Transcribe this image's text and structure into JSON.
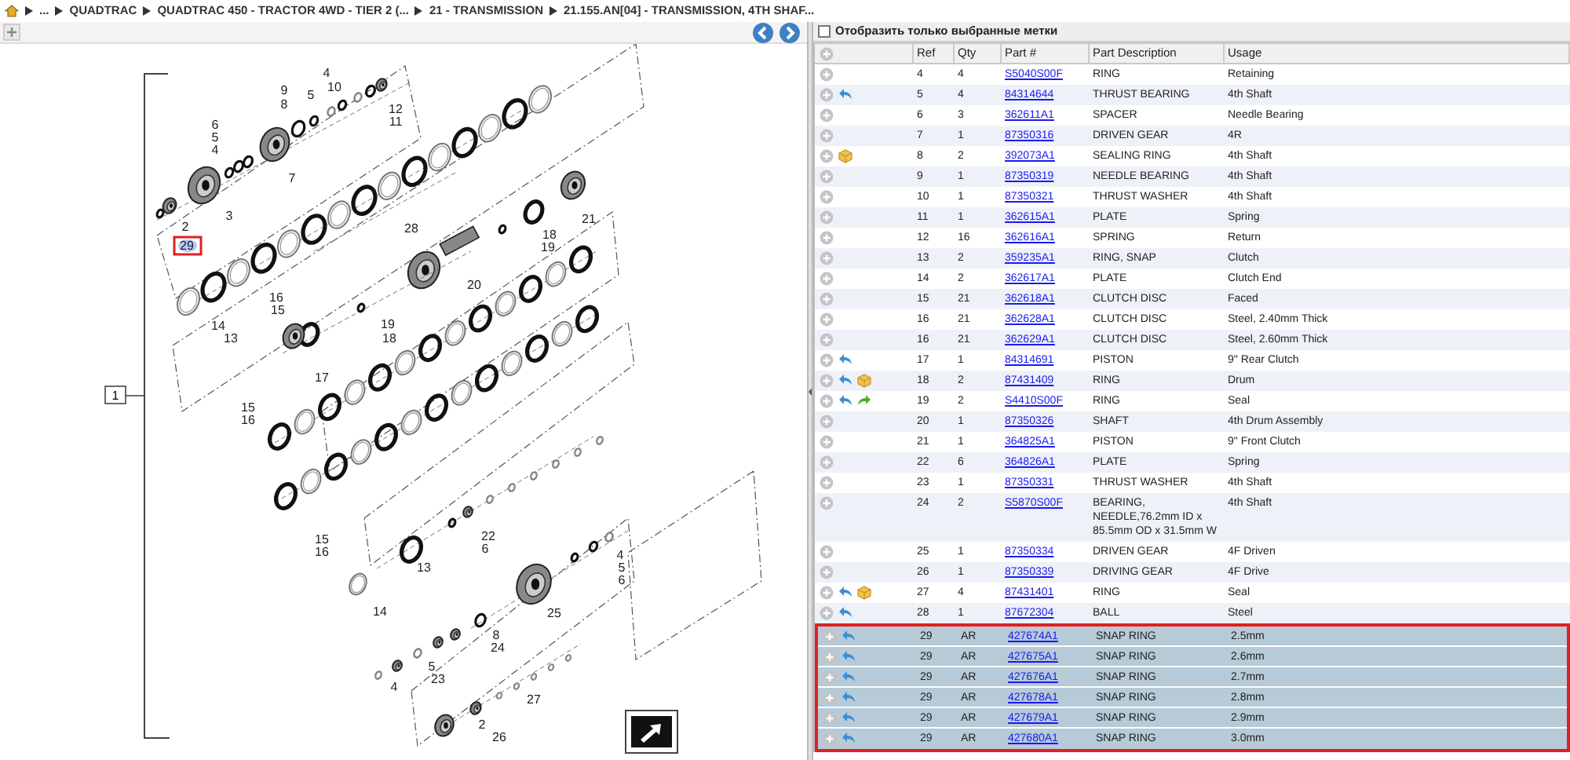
{
  "breadcrumb": [
    "...",
    "QUADTRAC",
    "QUADTRAC 450 - TRACTOR 4WD - TIER 2 (...",
    "21 - TRANSMISSION",
    "21.155.AN[04] - TRANSMISSION, 4TH SHAF..."
  ],
  "diagram": {
    "callouts": [
      {
        "label": "4",
        "selected": false
      },
      {
        "label": "9",
        "selected": false
      },
      {
        "label": "10",
        "selected": false
      },
      {
        "label": "5",
        "selected": false
      },
      {
        "label": "8",
        "selected": false
      },
      {
        "label": "12",
        "selected": false
      },
      {
        "label": "11",
        "selected": false
      },
      {
        "label": "6",
        "selected": false
      },
      {
        "label": "5",
        "selected": false
      },
      {
        "label": "4",
        "selected": false
      },
      {
        "label": "7",
        "selected": false
      },
      {
        "label": "3",
        "selected": false
      },
      {
        "label": "2",
        "selected": false
      },
      {
        "label": "29",
        "selected": true
      },
      {
        "label": "28",
        "selected": false
      },
      {
        "label": "18",
        "selected": false
      },
      {
        "label": "19",
        "selected": false
      },
      {
        "label": "21",
        "selected": false
      },
      {
        "label": "20",
        "selected": false
      },
      {
        "label": "16",
        "selected": false
      },
      {
        "label": "15",
        "selected": false
      },
      {
        "label": "14",
        "selected": false
      },
      {
        "label": "13",
        "selected": false
      },
      {
        "label": "19",
        "selected": false
      },
      {
        "label": "18",
        "selected": false
      },
      {
        "label": "17",
        "selected": false
      },
      {
        "label": "15",
        "selected": false
      },
      {
        "label": "16",
        "selected": false
      },
      {
        "label": "15",
        "selected": false
      },
      {
        "label": "16",
        "selected": false
      },
      {
        "label": "22",
        "selected": false
      },
      {
        "label": "6",
        "selected": false
      },
      {
        "label": "13",
        "selected": false
      },
      {
        "label": "14",
        "selected": false
      },
      {
        "label": "4",
        "selected": false
      },
      {
        "label": "5",
        "selected": false
      },
      {
        "label": "6",
        "selected": false
      },
      {
        "label": "25",
        "selected": false
      },
      {
        "label": "8",
        "selected": false
      },
      {
        "label": "24",
        "selected": false
      },
      {
        "label": "5",
        "selected": false
      },
      {
        "label": "23",
        "selected": false
      },
      {
        "label": "4",
        "selected": false
      },
      {
        "label": "27",
        "selected": false
      },
      {
        "label": "2",
        "selected": false
      },
      {
        "label": "26",
        "selected": false
      }
    ],
    "assembly_label": "1"
  },
  "filter": {
    "label": "Отобразить только выбранные метки",
    "checked": false
  },
  "columns": [
    "Ref",
    "Qty",
    "Part #",
    "Part Description",
    "Usage"
  ],
  "rows": [
    {
      "ref": "4",
      "qty": "4",
      "part": "S5040S00F",
      "description": "RING",
      "usage": "Retaining",
      "superseded": false,
      "kit": false,
      "replacement": false,
      "selected": false
    },
    {
      "ref": "5",
      "qty": "4",
      "part": "84314644",
      "description": "THRUST BEARING",
      "usage": "4th Shaft",
      "superseded": true,
      "kit": false,
      "replacement": false,
      "selected": false
    },
    {
      "ref": "6",
      "qty": "3",
      "part": "362611A1",
      "description": "SPACER",
      "usage": "Needle Bearing",
      "superseded": false,
      "kit": false,
      "replacement": false,
      "selected": false
    },
    {
      "ref": "7",
      "qty": "1",
      "part": "87350316",
      "description": "DRIVEN GEAR",
      "usage": "4R",
      "superseded": false,
      "kit": false,
      "replacement": false,
      "selected": false
    },
    {
      "ref": "8",
      "qty": "2",
      "part": "392073A1",
      "description": "SEALING RING",
      "usage": "4th Shaft",
      "superseded": false,
      "kit": true,
      "replacement": false,
      "selected": false
    },
    {
      "ref": "9",
      "qty": "1",
      "part": "87350319",
      "description": "NEEDLE BEARING",
      "usage": "4th Shaft",
      "superseded": false,
      "kit": false,
      "replacement": false,
      "selected": false
    },
    {
      "ref": "10",
      "qty": "1",
      "part": "87350321",
      "description": "THRUST WASHER",
      "usage": "4th Shaft",
      "superseded": false,
      "kit": false,
      "replacement": false,
      "selected": false
    },
    {
      "ref": "11",
      "qty": "1",
      "part": "362615A1",
      "description": "PLATE",
      "usage": "Spring",
      "superseded": false,
      "kit": false,
      "replacement": false,
      "selected": false
    },
    {
      "ref": "12",
      "qty": "16",
      "part": "362616A1",
      "description": "SPRING",
      "usage": "Return",
      "superseded": false,
      "kit": false,
      "replacement": false,
      "selected": false
    },
    {
      "ref": "13",
      "qty": "2",
      "part": "359235A1",
      "description": "RING, SNAP",
      "usage": "Clutch",
      "superseded": false,
      "kit": false,
      "replacement": false,
      "selected": false
    },
    {
      "ref": "14",
      "qty": "2",
      "part": "362617A1",
      "description": "PLATE",
      "usage": "Clutch End",
      "superseded": false,
      "kit": false,
      "replacement": false,
      "selected": false
    },
    {
      "ref": "15",
      "qty": "21",
      "part": "362618A1",
      "description": "CLUTCH DISC",
      "usage": "Faced",
      "superseded": false,
      "kit": false,
      "replacement": false,
      "selected": false
    },
    {
      "ref": "16",
      "qty": "21",
      "part": "362628A1",
      "description": "CLUTCH DISC",
      "usage": "Steel, 2.40mm Thick",
      "superseded": false,
      "kit": false,
      "replacement": false,
      "selected": false
    },
    {
      "ref": "16",
      "qty": "21",
      "part": "362629A1",
      "description": "CLUTCH DISC",
      "usage": "Steel, 2.60mm Thick",
      "superseded": false,
      "kit": false,
      "replacement": false,
      "selected": false
    },
    {
      "ref": "17",
      "qty": "1",
      "part": "84314691",
      "description": "PISTON",
      "usage": "9\" Rear Clutch",
      "superseded": true,
      "kit": false,
      "replacement": false,
      "selected": false
    },
    {
      "ref": "18",
      "qty": "2",
      "part": "87431409",
      "description": "RING",
      "usage": "Drum",
      "superseded": true,
      "kit": true,
      "replacement": false,
      "selected": false
    },
    {
      "ref": "19",
      "qty": "2",
      "part": "S4410S00F",
      "description": "RING",
      "usage": "Seal",
      "superseded": true,
      "kit": false,
      "replacement": true,
      "selected": false
    },
    {
      "ref": "20",
      "qty": "1",
      "part": "87350326",
      "description": "SHAFT",
      "usage": "4th Drum Assembly",
      "superseded": false,
      "kit": false,
      "replacement": false,
      "selected": false
    },
    {
      "ref": "21",
      "qty": "1",
      "part": "364825A1",
      "description": "PISTON",
      "usage": "9\" Front Clutch",
      "superseded": false,
      "kit": false,
      "replacement": false,
      "selected": false
    },
    {
      "ref": "22",
      "qty": "6",
      "part": "364826A1",
      "description": "PLATE",
      "usage": "Spring",
      "superseded": false,
      "kit": false,
      "replacement": false,
      "selected": false
    },
    {
      "ref": "23",
      "qty": "1",
      "part": "87350331",
      "description": "THRUST WASHER",
      "usage": "4th Shaft",
      "superseded": false,
      "kit": false,
      "replacement": false,
      "selected": false
    },
    {
      "ref": "24",
      "qty": "2",
      "part": "S5870S00F",
      "description": "BEARING, NEEDLE,76.2mm ID x 85.5mm OD x 31.5mm W",
      "usage": "4th Shaft",
      "superseded": false,
      "kit": false,
      "replacement": false,
      "selected": false
    },
    {
      "ref": "25",
      "qty": "1",
      "part": "87350334",
      "description": "DRIVEN GEAR",
      "usage": "4F Driven",
      "superseded": false,
      "kit": false,
      "replacement": false,
      "selected": false
    },
    {
      "ref": "26",
      "qty": "1",
      "part": "87350339",
      "description": "DRIVING GEAR",
      "usage": "4F Drive",
      "superseded": false,
      "kit": false,
      "replacement": false,
      "selected": false
    },
    {
      "ref": "27",
      "qty": "4",
      "part": "87431401",
      "description": "RING",
      "usage": "Seal",
      "superseded": true,
      "kit": true,
      "replacement": false,
      "selected": false
    },
    {
      "ref": "28",
      "qty": "1",
      "part": "87672304",
      "description": "BALL",
      "usage": "Steel",
      "superseded": true,
      "kit": false,
      "replacement": false,
      "selected": false
    },
    {
      "ref": "29",
      "qty": "AR",
      "part": "427674A1",
      "description": "SNAP RING",
      "usage": "2.5mm",
      "superseded": true,
      "kit": false,
      "replacement": false,
      "selected": true
    },
    {
      "ref": "29",
      "qty": "AR",
      "part": "427675A1",
      "description": "SNAP RING",
      "usage": "2.6mm",
      "superseded": true,
      "kit": false,
      "replacement": false,
      "selected": true
    },
    {
      "ref": "29",
      "qty": "AR",
      "part": "427676A1",
      "description": "SNAP RING",
      "usage": "2.7mm",
      "superseded": true,
      "kit": false,
      "replacement": false,
      "selected": true
    },
    {
      "ref": "29",
      "qty": "AR",
      "part": "427678A1",
      "description": "SNAP RING",
      "usage": "2.8mm",
      "superseded": true,
      "kit": false,
      "replacement": false,
      "selected": true
    },
    {
      "ref": "29",
      "qty": "AR",
      "part": "427679A1",
      "description": "SNAP RING",
      "usage": "2.9mm",
      "superseded": true,
      "kit": false,
      "replacement": false,
      "selected": true
    },
    {
      "ref": "29",
      "qty": "AR",
      "part": "427680A1",
      "description": "SNAP RING",
      "usage": "3.0mm",
      "superseded": true,
      "kit": false,
      "replacement": false,
      "selected": true
    }
  ]
}
